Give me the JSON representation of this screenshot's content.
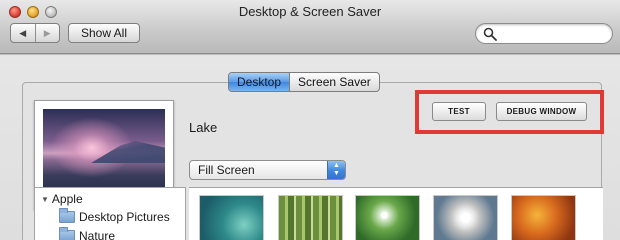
{
  "window": {
    "title": "Desktop & Screen Saver"
  },
  "toolbar": {
    "back_icon": "left-triangle-icon",
    "forward_icon": "right-triangle-icon",
    "show_all_label": "Show All",
    "search_placeholder": "",
    "search_value": ""
  },
  "tabs": [
    {
      "label": "Desktop",
      "selected": true
    },
    {
      "label": "Screen Saver",
      "selected": false
    }
  ],
  "desktop": {
    "wallpaper_name": "Lake",
    "fit_mode": "Fill Screen",
    "buttons": {
      "test_label": "TEST",
      "debug_window_label": "DEBUG WINDOW"
    },
    "highlight_color": "#e03a34"
  },
  "sources": {
    "group_label": "Apple",
    "items": [
      "Desktop Pictures",
      "Nature"
    ]
  },
  "thumbnails": [
    {
      "icon": "agave-thumbnail"
    },
    {
      "icon": "bamboo-thumbnail"
    },
    {
      "icon": "dew-drop-thumbnail"
    },
    {
      "icon": "dandelion-thumbnail"
    },
    {
      "icon": "autumn-leaves-thumbnail"
    }
  ],
  "colors": {
    "selected_tab": "#3f86e0",
    "window_bg": "#e3e3e3"
  }
}
